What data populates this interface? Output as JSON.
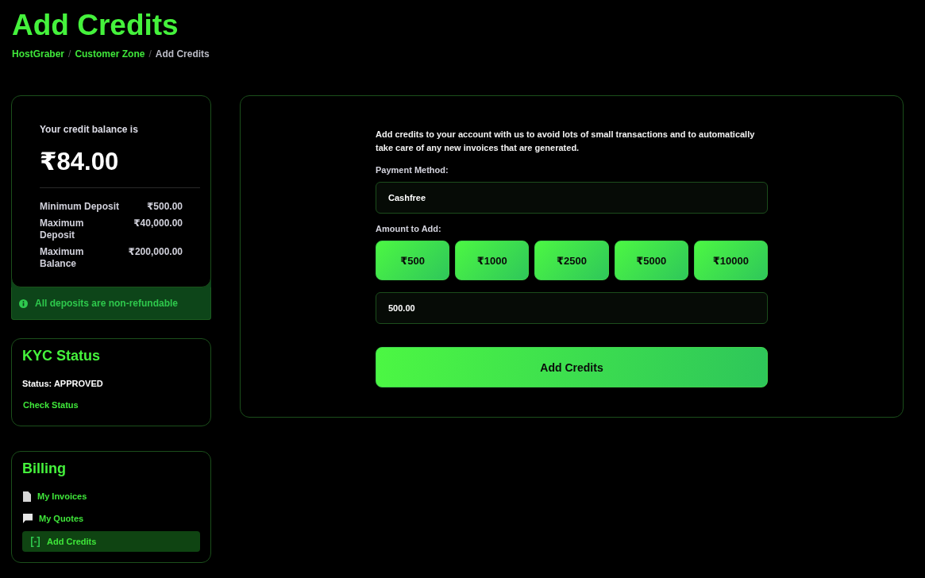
{
  "page": {
    "title": "Add Credits"
  },
  "breadcrumb": {
    "separator": "/",
    "items": [
      {
        "label": "HostGraber",
        "current": false
      },
      {
        "label": "Customer Zone",
        "current": false
      },
      {
        "label": "Add Credits",
        "current": true
      }
    ]
  },
  "balance_card": {
    "caption": "Your credit balance is",
    "amount": "₹84.00",
    "limits": [
      {
        "label": "Minimum Deposit",
        "value": "₹500.00"
      },
      {
        "label": "Maximum Deposit",
        "value": "₹40,000.00"
      },
      {
        "label": "Maximum Balance",
        "value": "₹200,000.00"
      }
    ],
    "notice": "All deposits are non-refundable"
  },
  "kyc": {
    "title": "KYC Status",
    "status": "Status: APPROVED",
    "link": "Check Status"
  },
  "billing": {
    "title": "Billing",
    "items": [
      {
        "label": "My Invoices",
        "selected": false
      },
      {
        "label": "My Quotes",
        "selected": false
      },
      {
        "label": "Add Credits",
        "selected": true
      }
    ]
  },
  "form": {
    "intro": "Add credits to your account with us to avoid lots of small transactions and to automatically take care of any new invoices that are generated.",
    "payment_label": "Payment Method:",
    "payment_method": {
      "value": "Cashfree"
    },
    "amount_label": "Amount to Add:",
    "presets": [
      "₹500",
      "₹1000",
      "₹2500",
      "₹5000",
      "₹10000"
    ],
    "amount": {
      "value": "500.00"
    },
    "submit": "Add Credits"
  }
}
